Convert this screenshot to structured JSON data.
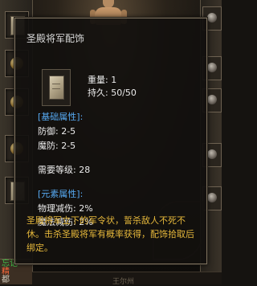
{
  "tooltip": {
    "title": "圣殿将军配饰",
    "weight": "重量: 1",
    "durability": "持久: 50/50",
    "basic_header": "[基础属性]:",
    "defense": "防御: 2-5",
    "magic_defense": "魔防: 2-5",
    "required_level": "需要等级: 28",
    "element_header": "[元素属性]:",
    "physical_reduction": "物理减伤: 2%",
    "magic_reduction": "魔法减伤: 2%",
    "description": "圣殿将军立下的军令状，誓杀敌人不死不休。击杀圣殿将军有概率获得，配饰拾取后绑定。"
  },
  "background": {
    "bottom_left_lines": [
      "忘记",
      "精",
      "都"
    ],
    "bottom_strip_text": "王尔州"
  },
  "colors": {
    "section_header": "#57aaf3",
    "description": "#e6b83b",
    "text": "#ececec",
    "border": "#7f735f"
  }
}
